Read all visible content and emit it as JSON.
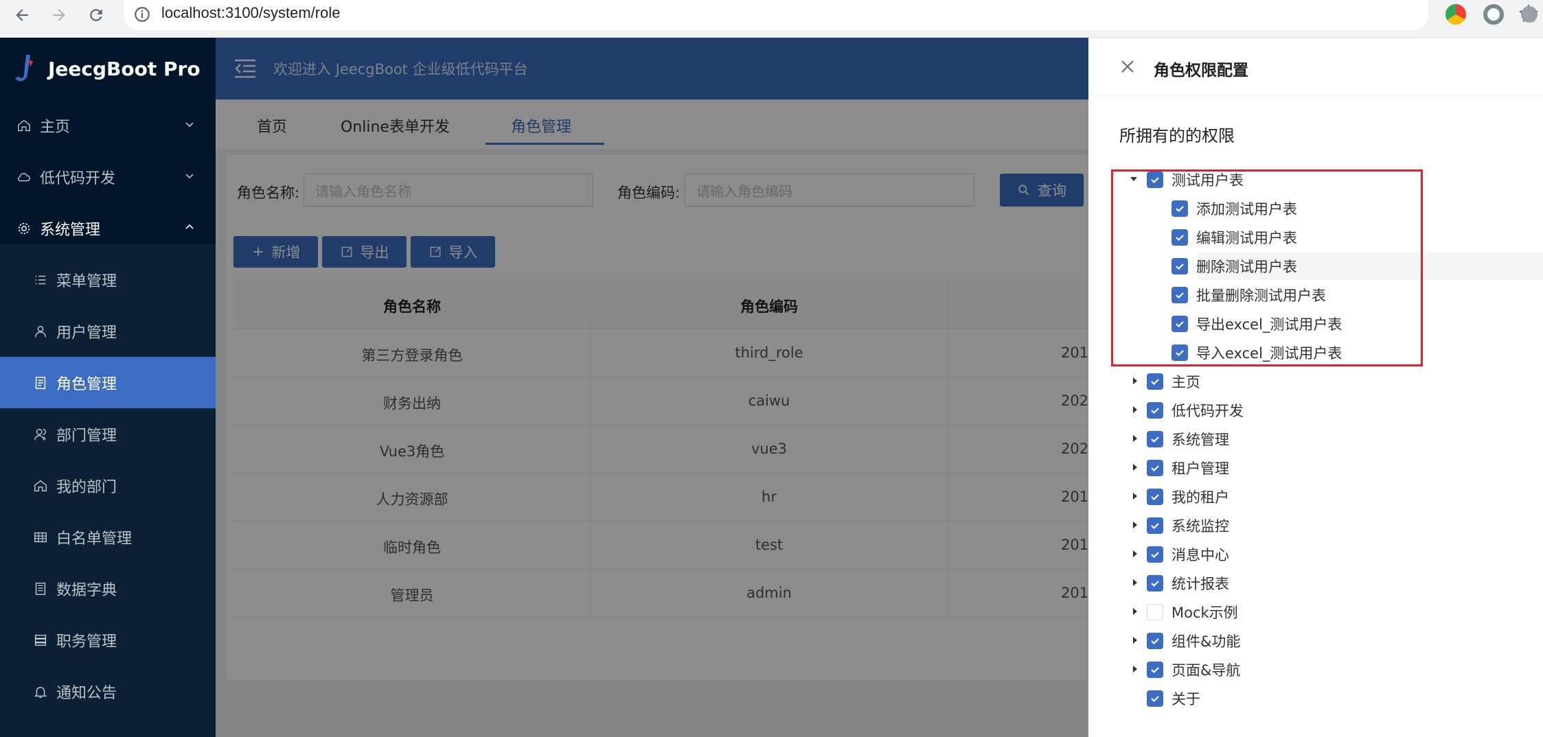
{
  "browser": {
    "url": "localhost:3100/system/role"
  },
  "sidebar": {
    "logo_text": "JeecgBoot Pro",
    "top_items": [
      {
        "label": "主页"
      },
      {
        "label": "低代码开发"
      },
      {
        "label": "系统管理"
      }
    ],
    "sub_items": [
      {
        "label": "菜单管理"
      },
      {
        "label": "用户管理"
      },
      {
        "label": "角色管理"
      },
      {
        "label": "部门管理"
      },
      {
        "label": "我的部门"
      },
      {
        "label": "白名单管理"
      },
      {
        "label": "数据字典"
      },
      {
        "label": "职务管理"
      },
      {
        "label": "通知公告"
      }
    ]
  },
  "header": {
    "welcome": "欢迎进入 JeecgBoot 企业级低代码平台"
  },
  "tabs": [
    {
      "label": "首页"
    },
    {
      "label": "Online表单开发"
    },
    {
      "label": "角色管理"
    }
  ],
  "search": {
    "role_name_label": "角色名称:",
    "role_name_placeholder": "请输入角色名称",
    "role_code_label": "角色编码:",
    "role_code_placeholder": "请输入角色编码",
    "query_label": "查询"
  },
  "toolbar": {
    "add_label": "新增",
    "export_label": "导出",
    "import_label": "导入"
  },
  "table": {
    "columns": [
      "角色名称",
      "角色编码"
    ],
    "rows": [
      {
        "name": "第三方登录角色",
        "code": "third_role",
        "extra": "201"
      },
      {
        "name": "财务出纳",
        "code": "caiwu",
        "extra": "202"
      },
      {
        "name": "Vue3角色",
        "code": "vue3",
        "extra": "202"
      },
      {
        "name": "人力资源部",
        "code": "hr",
        "extra": "201"
      },
      {
        "name": "临时角色",
        "code": "test",
        "extra": "201"
      },
      {
        "name": "管理员",
        "code": "admin",
        "extra": "201"
      }
    ]
  },
  "drawer": {
    "title": "角色权限配置",
    "section_title": "所拥有的的权限",
    "expanded_node": {
      "label": "测试用户表",
      "checked": true,
      "children": [
        {
          "label": "添加测试用户表",
          "checked": true
        },
        {
          "label": "编辑测试用户表",
          "checked": true
        },
        {
          "label": "删除测试用户表",
          "checked": true
        },
        {
          "label": "批量删除测试用户表",
          "checked": true
        },
        {
          "label": "导出excel_测试用户表",
          "checked": true
        },
        {
          "label": "导入excel_测试用户表",
          "checked": true
        }
      ]
    },
    "nodes": [
      {
        "label": "主页",
        "checked": true
      },
      {
        "label": "低代码开发",
        "checked": true
      },
      {
        "label": "系统管理",
        "checked": true
      },
      {
        "label": "租户管理",
        "checked": true
      },
      {
        "label": "我的租户",
        "checked": true
      },
      {
        "label": "系统监控",
        "checked": true
      },
      {
        "label": "消息中心",
        "checked": true
      },
      {
        "label": "统计报表",
        "checked": true
      },
      {
        "label": "Mock示例",
        "checked": false
      },
      {
        "label": "组件&功能",
        "checked": true
      },
      {
        "label": "页面&导航",
        "checked": true
      },
      {
        "label": "关于",
        "checked": true
      }
    ]
  },
  "colors": {
    "primary": "#3d6cc4",
    "sidebar_bg": "#001529",
    "highlight_border": "#e0212b"
  }
}
